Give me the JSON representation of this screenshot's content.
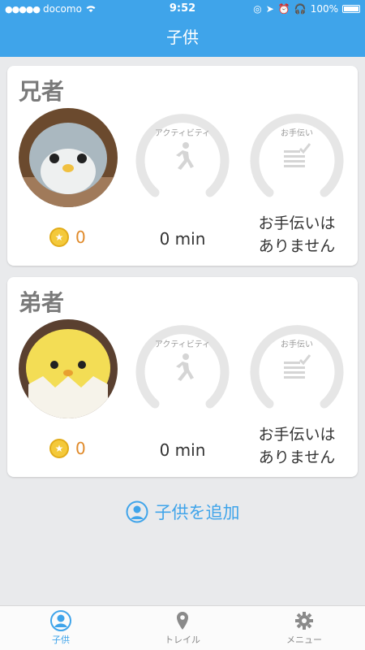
{
  "status": {
    "carrier": "docomo",
    "time": "9:52",
    "battery": "100%"
  },
  "nav": {
    "title": "子供"
  },
  "children": [
    {
      "name": "兄者",
      "coins": "0",
      "activity_label": "アクティビティ",
      "activity_value": "0 min",
      "chores_label": "お手伝い",
      "chores_value_line1": "お手伝いは",
      "chores_value_line2": "ありません"
    },
    {
      "name": "弟者",
      "coins": "0",
      "activity_label": "アクティビティ",
      "activity_value": "0 min",
      "chores_label": "お手伝い",
      "chores_value_line1": "お手伝いは",
      "chores_value_line2": "ありません"
    }
  ],
  "add_child_label": "子供を追加",
  "tabs": [
    {
      "label": "子供",
      "icon": "person-icon",
      "active": true
    },
    {
      "label": "トレイル",
      "icon": "map-pin-icon",
      "active": false
    },
    {
      "label": "メニュー",
      "icon": "gear-icon",
      "active": false
    }
  ],
  "colors": {
    "accent": "#3fa4ea",
    "coin": "#f4c93a",
    "coin_text": "#e08a2a",
    "ring": "#e6e6e6"
  }
}
